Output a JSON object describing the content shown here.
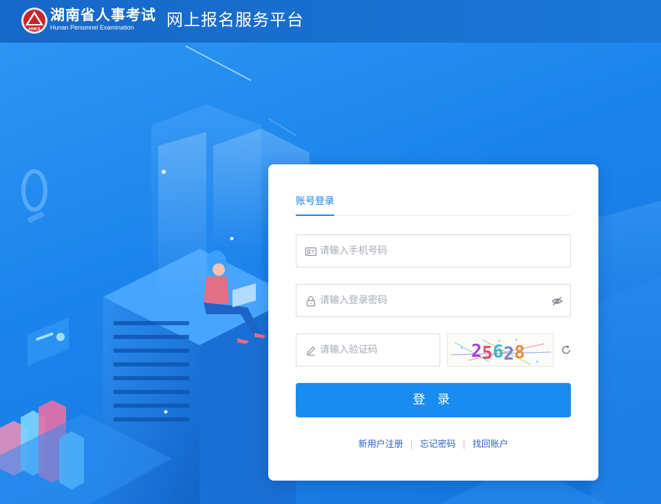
{
  "header": {
    "logo_badge": "HNKS",
    "logo_name": "湖南省人事考试",
    "logo_english": "Hunan Personnel Examination",
    "platform_title": "网上报名服务平台"
  },
  "login": {
    "tab_label": "账号登录",
    "phone_placeholder": "请输入手机号码",
    "password_placeholder": "请输入登录密码",
    "code_placeholder": "请输入验证码",
    "captcha_text": "25628",
    "submit_label": "登 录"
  },
  "links": {
    "register": "新用户注册",
    "forgot_password": "忘记密码",
    "recover_account": "找回账户",
    "separator": "|"
  },
  "colors": {
    "header_bg": "#1b72d2",
    "scene_bg": "#1b84ec",
    "accent": "#1a8cf0",
    "link": "#2a5fc2"
  },
  "icons": {
    "phone_field": "id-card-icon",
    "password_field": "lock-icon",
    "password_toggle": "eye-off-icon",
    "code_field": "pencil-icon",
    "captcha_refresh": "refresh-icon"
  }
}
